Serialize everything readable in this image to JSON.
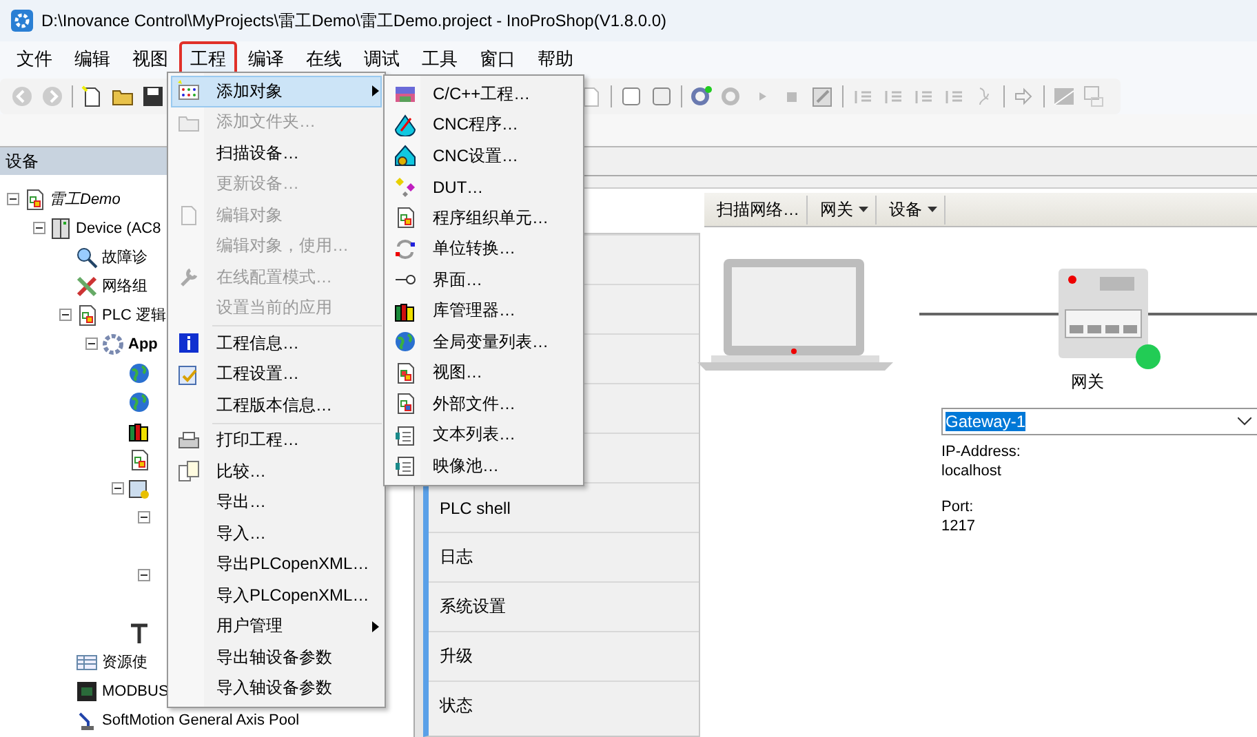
{
  "window": {
    "title": "D:\\Inovance Control\\MyProjects\\雷工Demo\\雷工Demo.project - InoProShop(V1.8.0.0)"
  },
  "menu_bar": [
    {
      "label": "文件",
      "selected": false
    },
    {
      "label": "编辑",
      "selected": false
    },
    {
      "label": "视图",
      "selected": false
    },
    {
      "label": "工程",
      "selected": true
    },
    {
      "label": "编译",
      "selected": false
    },
    {
      "label": "在线",
      "selected": false
    },
    {
      "label": "调试",
      "selected": false
    },
    {
      "label": "工具",
      "selected": false
    },
    {
      "label": "窗口",
      "selected": false
    },
    {
      "label": "帮助",
      "selected": false
    }
  ],
  "device_panel": {
    "title": "设备",
    "tree": [
      {
        "label": "雷工Demo",
        "kind": "project",
        "expanded": true,
        "children": [
          {
            "label": "Device (AC8",
            "kind": "device",
            "expanded": true,
            "children": [
              {
                "label": "故障诊",
                "kind": "diagnosis"
              },
              {
                "label": "网络组",
                "kind": "network"
              },
              {
                "label": "PLC 逻辑",
                "kind": "plc",
                "expanded": true,
                "children": [
                  {
                    "label": "App",
                    "kind": "application",
                    "expanded": true,
                    "children": [
                      {
                        "kind": "globe"
                      },
                      {
                        "kind": "globe"
                      },
                      {
                        "kind": "library"
                      },
                      {
                        "kind": "document"
                      },
                      {
                        "kind": "task",
                        "expanded": true,
                        "children": [
                          {
                            "expanded": true
                          },
                          {
                            "expanded": true
                          }
                        ]
                      },
                      {
                        "kind": "tee"
                      }
                    ]
                  }
                ]
              },
              {
                "label": "资源使",
                "kind": "resource"
              },
              {
                "label": "MODBUS",
                "kind": "modbus"
              },
              {
                "label": "SoftMotion General Axis Pool",
                "kind": "axis"
              }
            ]
          }
        ]
      }
    ]
  },
  "project_menu": [
    {
      "label": "添加对象",
      "kind": "add-object",
      "disabled": false,
      "selected": true,
      "submenu": true
    },
    {
      "label": "添加文件夹…",
      "kind": "folder",
      "disabled": true,
      "selected": false,
      "submenu": false
    },
    {
      "label": "扫描设备…",
      "kind": "plain",
      "disabled": false,
      "selected": false,
      "submenu": false
    },
    {
      "label": "更新设备…",
      "kind": "plain",
      "disabled": true,
      "selected": false,
      "submenu": false
    },
    {
      "label": "编辑对象",
      "kind": "edit",
      "disabled": true,
      "selected": false,
      "submenu": false
    },
    {
      "label": "编辑对象，使用…",
      "kind": "plain",
      "disabled": true,
      "selected": false,
      "submenu": false
    },
    {
      "label": "在线配置模式…",
      "kind": "wrench",
      "disabled": true,
      "selected": false,
      "submenu": false
    },
    {
      "label": "设置当前的应用",
      "kind": "plain",
      "disabled": true,
      "selected": false,
      "submenu": false
    },
    {
      "kind": "separator"
    },
    {
      "label": "工程信息…",
      "kind": "info",
      "disabled": false,
      "selected": false,
      "submenu": false
    },
    {
      "label": "工程设置…",
      "kind": "settings",
      "disabled": false,
      "selected": false,
      "submenu": false
    },
    {
      "label": "工程版本信息…",
      "kind": "plain",
      "disabled": false,
      "selected": false,
      "submenu": false
    },
    {
      "kind": "separator"
    },
    {
      "label": "打印工程…",
      "kind": "print",
      "disabled": false,
      "selected": false,
      "submenu": false
    },
    {
      "label": "比较…",
      "kind": "compare",
      "disabled": false,
      "selected": false,
      "submenu": false
    },
    {
      "label": "导出…",
      "kind": "plain",
      "disabled": false,
      "selected": false,
      "submenu": false
    },
    {
      "label": "导入…",
      "kind": "plain",
      "disabled": false,
      "selected": false,
      "submenu": false
    },
    {
      "label": "导出PLCopenXML…",
      "kind": "plain",
      "disabled": false,
      "selected": false,
      "submenu": false
    },
    {
      "label": "导入PLCopenXML…",
      "kind": "plain",
      "disabled": false,
      "selected": false,
      "submenu": false
    },
    {
      "label": "用户管理",
      "kind": "plain",
      "disabled": false,
      "selected": false,
      "submenu": true
    },
    {
      "label": "导出轴设备参数",
      "kind": "plain",
      "disabled": false,
      "selected": false,
      "submenu": false
    },
    {
      "label": "导入轴设备参数",
      "kind": "plain",
      "disabled": false,
      "selected": false,
      "submenu": false
    }
  ],
  "add_object_submenu": [
    {
      "label": "C/C++工程…",
      "kind": "cpp"
    },
    {
      "label": "CNC程序…",
      "kind": "cnc-program"
    },
    {
      "label": "CNC设置…",
      "kind": "cnc-settings"
    },
    {
      "label": "DUT…",
      "kind": "dut"
    },
    {
      "label": "程序组织单元…",
      "kind": "pou"
    },
    {
      "label": "单位转换…",
      "kind": "unit"
    },
    {
      "label": "界面…",
      "kind": "interface"
    },
    {
      "label": "库管理器…",
      "kind": "library"
    },
    {
      "label": "全局变量列表…",
      "kind": "globe"
    },
    {
      "label": "视图…",
      "kind": "view"
    },
    {
      "label": "外部文件…",
      "kind": "external"
    },
    {
      "label": "文本列表…",
      "kind": "textlist"
    },
    {
      "label": "映像池…",
      "kind": "textlist"
    }
  ],
  "device_pages": [
    {
      "label": "PLC shell"
    },
    {
      "label": "日志"
    },
    {
      "label": "系统设置"
    },
    {
      "label": "升级"
    },
    {
      "label": "状态"
    }
  ],
  "network_toolbar": [
    {
      "label": "扫描网络…",
      "dropdown": false
    },
    {
      "label": "网关",
      "dropdown": true
    },
    {
      "label": "设备",
      "dropdown": true
    }
  ],
  "gateway": {
    "label": "网关",
    "online": true,
    "selection": "Gateway-1",
    "ip_label": "IP-Address:",
    "ip": "localhost",
    "port_label": "Port:",
    "port": "1217"
  }
}
